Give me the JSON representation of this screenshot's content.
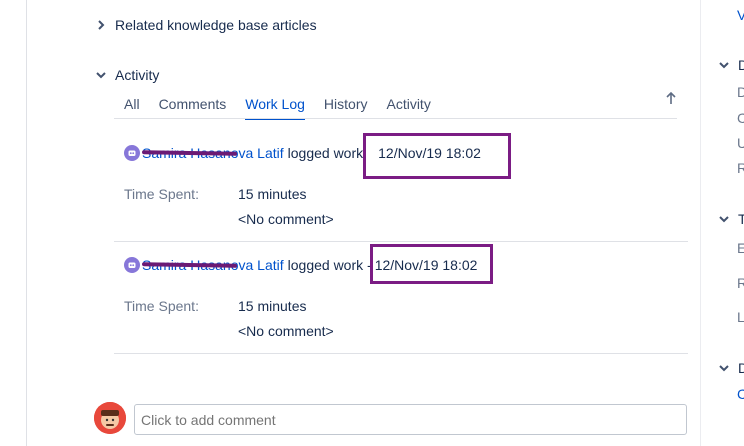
{
  "sections": {
    "related_label": "Related knowledge base articles",
    "activity_label": "Activity"
  },
  "tabs": [
    {
      "label": "All"
    },
    {
      "label": "Comments"
    },
    {
      "label": "Work Log"
    },
    {
      "label": "History"
    },
    {
      "label": "Activity"
    }
  ],
  "worklogs": [
    {
      "author": "Samira Hasanova Latif",
      "action": "logged work",
      "date": "12/Nov/19 18:02",
      "time_spent_label": "Time Spent:",
      "time_spent": "15 minutes",
      "comment": "<No comment>"
    },
    {
      "author": "Samira Hasanova Latif",
      "action": "logged work -",
      "date": "12/Nov/19 18:02",
      "time_spent_label": "Time Spent:",
      "time_spent": "15 minutes",
      "comment": "<No comment>"
    }
  ],
  "comment_box": {
    "placeholder": "Click to add comment"
  },
  "right_panel": {
    "top_link": "V",
    "section1_initial": "D",
    "section1_rows": [
      "D",
      "C",
      "U",
      "R"
    ],
    "section2_initial": "T",
    "section2_rows": [
      "E",
      "R",
      "L"
    ],
    "section3_initial": "D",
    "section3_link": "C"
  },
  "colors": {
    "link": "#0052cc",
    "highlight": "#7b1c84",
    "avatar": "#8777d9"
  }
}
